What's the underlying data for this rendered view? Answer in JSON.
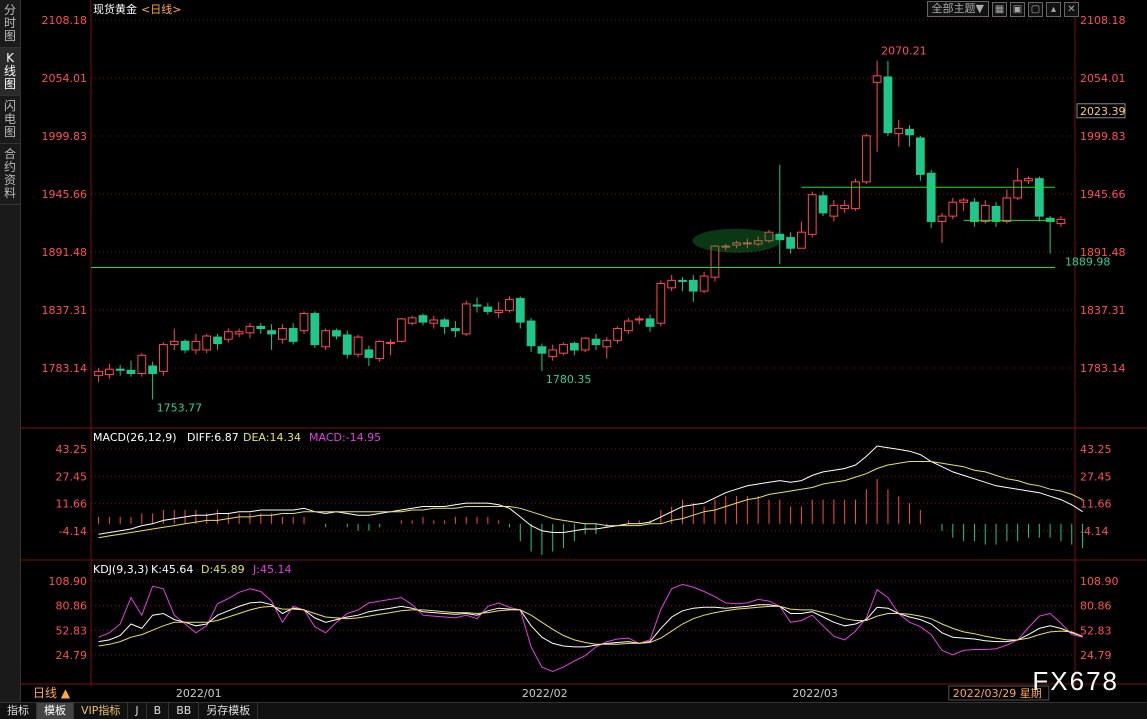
{
  "sidebar": {
    "items": [
      "分时图",
      "K线图",
      "闪电图",
      "合约资料"
    ],
    "active_index": 1
  },
  "toolbar": {
    "theme_label": "全部主题▼",
    "icons": [
      "grid-icon",
      "image-icon",
      "restore-icon",
      "up-icon",
      "close-icon"
    ]
  },
  "title": {
    "instrument": "现货黄金",
    "period": "<日线>"
  },
  "price_axis": {
    "ticks": [
      "2108.18",
      "2054.01",
      "1999.83",
      "1945.66",
      "1891.48",
      "1837.31",
      "1783.14"
    ],
    "current": "2023.39"
  },
  "annotations": {
    "high": "2070.21",
    "low1": "1753.77",
    "low2": "1780.35",
    "low3": "1889.98"
  },
  "macd": {
    "header": "MACD(26,12,9)",
    "diff": "DIFF:6.87",
    "dea": "DEA:14.34",
    "macd": "MACD:-14.95",
    "ticks": [
      "43.25",
      "27.45",
      "11.66",
      "-4.14"
    ]
  },
  "kdj": {
    "header": "KDJ(9,3,3)",
    "k": "K:45.64",
    "d": "D:45.89",
    "j": "J:45.14",
    "ticks": [
      "108.90",
      "80.86",
      "52.83",
      "24.79"
    ]
  },
  "time_axis": {
    "period_label": "日线 ▲",
    "labels": [
      "2022/01",
      "2022/02",
      "2022/03"
    ],
    "cursor_date": "2022/03/29 星期"
  },
  "bottom_tabs": [
    "指标",
    "模板",
    "VIP指标",
    "J",
    "B",
    "BB",
    "另存模板"
  ],
  "bottom_active": 1,
  "watermark": "FX678",
  "colors": {
    "up": "#ff4a4a",
    "down": "#1ec88a",
    "grid": "#7a1010",
    "white_line": "#ffffff",
    "yellow_line": "#e8e060",
    "magenta_line": "#e040e0",
    "support": "#22dd22"
  },
  "chart_data": [
    {
      "type": "candlestick",
      "title": "现货黄金 <日线>",
      "ylim": [
        1740,
        2115
      ],
      "candles": [
        [
          1776,
          1780,
          1770,
          1783
        ],
        [
          1777,
          1782,
          1773,
          1787
        ],
        [
          1782,
          1781,
          1776,
          1786
        ],
        [
          1781,
          1778,
          1775,
          1790
        ],
        [
          1778,
          1795,
          1775,
          1797
        ],
        [
          1785,
          1778,
          1753.77,
          1789
        ],
        [
          1780,
          1805,
          1776,
          1807
        ],
        [
          1805,
          1808,
          1800,
          1820
        ],
        [
          1808,
          1800,
          1797,
          1810
        ],
        [
          1800,
          1808,
          1796,
          1815
        ],
        [
          1800,
          1813,
          1797,
          1815
        ],
        [
          1812,
          1806,
          1800,
          1815
        ],
        [
          1810,
          1817,
          1807,
          1820
        ],
        [
          1815,
          1817,
          1812,
          1820
        ],
        [
          1816,
          1822,
          1811,
          1825
        ],
        [
          1822,
          1820,
          1815,
          1825
        ],
        [
          1818,
          1815,
          1800,
          1824
        ],
        [
          1810,
          1820,
          1806,
          1824
        ],
        [
          1820,
          1808,
          1805,
          1825
        ],
        [
          1818,
          1834,
          1815,
          1836
        ],
        [
          1834,
          1805,
          1802,
          1836
        ],
        [
          1803,
          1818,
          1800,
          1820
        ],
        [
          1818,
          1813,
          1810,
          1820
        ],
        [
          1814,
          1796,
          1792,
          1818
        ],
        [
          1796,
          1812,
          1793,
          1814
        ],
        [
          1800,
          1793,
          1785,
          1804
        ],
        [
          1792,
          1808,
          1789,
          1809
        ],
        [
          1807,
          1807,
          1795,
          1810
        ],
        [
          1808,
          1829,
          1807,
          1830
        ],
        [
          1825,
          1830,
          1823,
          1832
        ],
        [
          1832,
          1826,
          1823,
          1834
        ],
        [
          1825,
          1828,
          1820,
          1832
        ],
        [
          1828,
          1822,
          1815,
          1830
        ],
        [
          1820,
          1818,
          1812,
          1827
        ],
        [
          1815,
          1843,
          1813,
          1846
        ],
        [
          1842,
          1841,
          1835,
          1849
        ],
        [
          1840,
          1836,
          1833,
          1844
        ],
        [
          1835,
          1837,
          1830,
          1845
        ],
        [
          1837,
          1847,
          1835,
          1850
        ],
        [
          1848,
          1826,
          1820,
          1850
        ],
        [
          1827,
          1804,
          1798,
          1830
        ],
        [
          1803,
          1797,
          1780.35,
          1806
        ],
        [
          1794,
          1800,
          1790,
          1805
        ],
        [
          1797,
          1805,
          1795,
          1807
        ],
        [
          1806,
          1800,
          1795,
          1808
        ],
        [
          1800,
          1811,
          1798,
          1812
        ],
        [
          1810,
          1805,
          1800,
          1815
        ],
        [
          1803,
          1809,
          1792,
          1812
        ],
        [
          1809,
          1820,
          1806,
          1822
        ],
        [
          1818,
          1827,
          1815,
          1830
        ],
        [
          1828,
          1829,
          1824,
          1832
        ],
        [
          1829,
          1822,
          1817,
          1833
        ],
        [
          1825,
          1862,
          1822,
          1865
        ],
        [
          1858,
          1865,
          1855,
          1870
        ],
        [
          1865,
          1864,
          1855,
          1868
        ],
        [
          1865,
          1855,
          1845,
          1870
        ],
        [
          1855,
          1869,
          1853,
          1873
        ],
        [
          1868,
          1897,
          1864,
          1898
        ],
        [
          1897,
          1897,
          1893,
          1899
        ],
        [
          1898,
          1900,
          1895,
          1902
        ],
        [
          1900,
          1900,
          1895,
          1904
        ],
        [
          1899,
          1902,
          1897,
          1906
        ],
        [
          1902,
          1910,
          1900,
          1912
        ],
        [
          1908,
          1903,
          1880,
          1973
        ],
        [
          1905,
          1895,
          1890,
          1910
        ],
        [
          1895,
          1910,
          1895,
          1920
        ],
        [
          1908,
          1945,
          1905,
          1948
        ],
        [
          1944,
          1928,
          1925,
          1948
        ],
        [
          1925,
          1935,
          1920,
          1940
        ],
        [
          1932,
          1935,
          1928,
          1940
        ],
        [
          1932,
          1957,
          1930,
          1960
        ],
        [
          1957,
          2000,
          1955,
          2002
        ],
        [
          2050,
          2056,
          1985,
          2070.21
        ],
        [
          2055,
          2003,
          2000,
          2070
        ],
        [
          2002,
          2007,
          1990,
          2015
        ],
        [
          2006,
          2001,
          1990,
          2010
        ],
        [
          1998,
          1964,
          1958,
          2000
        ],
        [
          1965,
          1920,
          1914,
          1968
        ],
        [
          1920,
          1925,
          1900,
          1928
        ],
        [
          1925,
          1938,
          1922,
          1942
        ],
        [
          1938,
          1940,
          1930,
          1942
        ],
        [
          1938,
          1920,
          1915,
          1942
        ],
        [
          1920,
          1935,
          1918,
          1940
        ],
        [
          1934,
          1920,
          1915,
          1938
        ],
        [
          1920,
          1942,
          1918,
          1950
        ],
        [
          1942,
          1958,
          1940,
          1970
        ],
        [
          1958,
          1960,
          1955,
          1962
        ],
        [
          1960,
          1925,
          1920,
          1962
        ],
        [
          1923,
          1920,
          1889.98,
          1925
        ],
        [
          1918,
          1922,
          1915,
          1925
        ]
      ],
      "support_lines": [
        1877,
        1921,
        1952
      ]
    },
    {
      "type": "line",
      "title": "MACD(26,12,9)",
      "ylim": [
        -20,
        50
      ],
      "series": [
        {
          "name": "DIFF",
          "values": [
            -6,
            -5,
            -4,
            -3,
            -1,
            0,
            2,
            3,
            4,
            5,
            5,
            6,
            6,
            7,
            7,
            8,
            8,
            8,
            8,
            9,
            7,
            6,
            7,
            6,
            5,
            5,
            6,
            7,
            8,
            9,
            10,
            10,
            10,
            11,
            12,
            12,
            12,
            11,
            9,
            4,
            -1,
            -4,
            -5,
            -5,
            -4,
            -3,
            -3,
            -2,
            -1,
            0,
            0,
            1,
            4,
            7,
            10,
            11,
            12,
            15,
            18,
            20,
            22,
            23,
            24,
            25,
            24,
            25,
            28,
            30,
            31,
            32,
            34,
            39,
            45,
            44,
            43,
            42,
            40,
            36,
            33,
            30,
            28,
            26,
            24,
            22,
            21,
            20,
            19,
            18,
            16,
            14,
            11,
            7
          ]
        },
        {
          "name": "DEA",
          "values": [
            -8,
            -7,
            -6,
            -5,
            -4,
            -3,
            -2,
            -1,
            0,
            1,
            2,
            2,
            3,
            4,
            4,
            5,
            5,
            6,
            6,
            7,
            7,
            7,
            7,
            7,
            7,
            7,
            7,
            7,
            7,
            8,
            8,
            9,
            9,
            9,
            10,
            10,
            10,
            10,
            10,
            9,
            7,
            5,
            3,
            2,
            1,
            0,
            0,
            -1,
            -1,
            -1,
            -1,
            0,
            0,
            2,
            3,
            5,
            7,
            8,
            10,
            12,
            14,
            15,
            17,
            18,
            19,
            20,
            21,
            23,
            24,
            25,
            27,
            29,
            32,
            34,
            35,
            36,
            36,
            36,
            35,
            34,
            33,
            31,
            30,
            28,
            26,
            25,
            23,
            22,
            20,
            19,
            17,
            14
          ]
        },
        {
          "name": "MACD",
          "values": [
            2,
            2,
            2,
            2,
            3,
            3,
            4,
            4,
            4,
            4,
            3,
            4,
            3,
            3,
            3,
            3,
            3,
            2,
            2,
            2,
            0,
            -1,
            0,
            -1,
            -2,
            -2,
            -1,
            0,
            1,
            1,
            2,
            1,
            1,
            2,
            2,
            2,
            2,
            1,
            -1,
            -5,
            -8,
            -9,
            -8,
            -7,
            -5,
            -3,
            -3,
            -1,
            0,
            1,
            1,
            1,
            4,
            5,
            7,
            6,
            5,
            7,
            8,
            8,
            8,
            8,
            7,
            7,
            5,
            5,
            7,
            7,
            7,
            7,
            7,
            10,
            13,
            10,
            8,
            6,
            4,
            0,
            -2,
            -4,
            -5,
            -5,
            -6,
            -6,
            -5,
            -5,
            -4,
            -4,
            -4,
            -5,
            -6,
            -7
          ]
        }
      ]
    },
    {
      "type": "line",
      "title": "KDJ(9,3,3)",
      "ylim": [
        10,
        115
      ],
      "series": [
        {
          "name": "K",
          "values": [
            40,
            42,
            47,
            60,
            55,
            70,
            72,
            65,
            62,
            58,
            60,
            70,
            75,
            80,
            84,
            85,
            82,
            72,
            78,
            76,
            67,
            62,
            65,
            68,
            70,
            74,
            76,
            78,
            80,
            78,
            74,
            73,
            72,
            71,
            72,
            70,
            75,
            78,
            77,
            76,
            58,
            45,
            38,
            35,
            34,
            34,
            36,
            38,
            39,
            40,
            38,
            40,
            55,
            68,
            75,
            78,
            79,
            79,
            78,
            79,
            80,
            82,
            82,
            80,
            72,
            72,
            74,
            68,
            62,
            58,
            60,
            65,
            79,
            78,
            72,
            68,
            65,
            60,
            50,
            45,
            44,
            43,
            41,
            40,
            40,
            42,
            48,
            55,
            58,
            55,
            50,
            46
          ]
        },
        {
          "name": "D",
          "values": [
            35,
            37,
            40,
            45,
            48,
            53,
            58,
            62,
            62,
            62,
            62,
            64,
            68,
            72,
            76,
            79,
            80,
            77,
            77,
            76,
            72,
            68,
            67,
            66,
            67,
            69,
            71,
            73,
            75,
            76,
            76,
            75,
            74,
            73,
            73,
            72,
            73,
            75,
            76,
            76,
            70,
            62,
            54,
            47,
            42,
            39,
            37,
            37,
            37,
            38,
            38,
            39,
            44,
            52,
            60,
            66,
            70,
            73,
            75,
            77,
            78,
            79,
            80,
            80,
            77,
            76,
            76,
            73,
            70,
            66,
            64,
            64,
            69,
            72,
            72,
            71,
            69,
            66,
            60,
            55,
            51,
            49,
            46,
            44,
            42,
            42,
            44,
            48,
            51,
            52,
            51,
            46
          ]
        },
        {
          "name": "J",
          "values": [
            45,
            50,
            60,
            90,
            70,
            103,
            100,
            70,
            60,
            50,
            58,
            83,
            89,
            96,
            100,
            97,
            86,
            62,
            80,
            76,
            57,
            50,
            62,
            72,
            76,
            84,
            86,
            88,
            90,
            82,
            70,
            69,
            68,
            67,
            70,
            66,
            80,
            84,
            79,
            76,
            34,
            11,
            6,
            11,
            18,
            24,
            34,
            40,
            43,
            44,
            38,
            42,
            77,
            100,
            105,
            102,
            97,
            91,
            84,
            83,
            84,
            88,
            86,
            80,
            62,
            64,
            70,
            58,
            46,
            42,
            52,
            67,
            99,
            90,
            72,
            62,
            57,
            48,
            30,
            25,
            30,
            31,
            31,
            32,
            36,
            42,
            56,
            69,
            72,
            61,
            48,
            45
          ]
        }
      ]
    }
  ]
}
